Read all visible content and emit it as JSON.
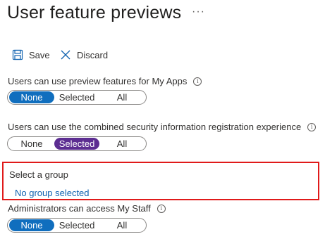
{
  "page": {
    "title": "User feature previews",
    "more": "···"
  },
  "toolbar": {
    "save_label": "Save",
    "discard_label": "Discard"
  },
  "settings": [
    {
      "label": "Users can use preview features for My Apps",
      "options": [
        "None",
        "Selected",
        "All"
      ],
      "selected": "None"
    },
    {
      "label": "Users can use the combined security information registration experience",
      "options": [
        "None",
        "Selected",
        "All"
      ],
      "selected": "Selected"
    },
    {
      "label": "Administrators can access My Staff",
      "options": [
        "None",
        "Selected",
        "All"
      ],
      "selected": "None"
    }
  ],
  "group": {
    "label": "Select a group",
    "link": "No group selected"
  },
  "colors": {
    "accent_blue": "#106ebe",
    "accent_purple": "#5c2d91",
    "highlight_red": "#e01a1a",
    "link_blue": "#0f62b0"
  }
}
